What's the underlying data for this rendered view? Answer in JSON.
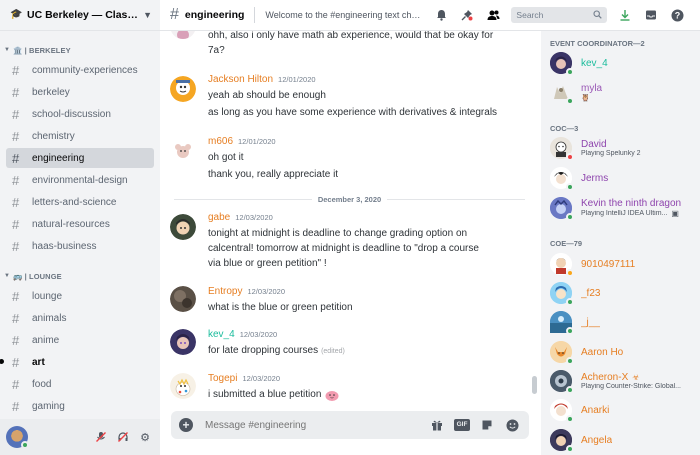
{
  "server": {
    "name": "UC Berkeley — Class o..."
  },
  "sidebar": {
    "categories": [
      {
        "label": "🏛️ | BERKELEY"
      },
      {
        "label": "🚌 | LOUNGE"
      }
    ],
    "channels": [
      {
        "label": "community-experiences"
      },
      {
        "label": "berkeley"
      },
      {
        "label": "school-discussion"
      },
      {
        "label": "chemistry"
      },
      {
        "label": "engineering"
      },
      {
        "label": "environmental-design"
      },
      {
        "label": "letters-and-science"
      },
      {
        "label": "natural-resources"
      },
      {
        "label": "haas-business"
      },
      {
        "label": "lounge"
      },
      {
        "label": "animals"
      },
      {
        "label": "anime"
      },
      {
        "label": "art"
      },
      {
        "label": "food"
      },
      {
        "label": "gaming"
      }
    ]
  },
  "topbar": {
    "channel": "engineering",
    "topic": "Welcome to the #engineering text cha...",
    "search_placeholder": "Search"
  },
  "messages": [
    {
      "lines": [
        "ohh, also i only have math ab experience, would that be okay for",
        "7a?"
      ]
    },
    {
      "author": "Jackson Hilton",
      "color": "#e67e22",
      "timestamp": "12/01/2020",
      "lines": [
        "yeah ab should be enough",
        "as long as you have some experience with derivatives & integrals"
      ]
    },
    {
      "author": "m606",
      "color": "#e67e22",
      "timestamp": "12/01/2020",
      "lines": [
        "oh got it",
        "thank you, really appreciate it"
      ]
    },
    {
      "author": "gabe",
      "color": "#e67e22",
      "timestamp": "12/03/2020",
      "lines": [
        "tonight at midnight is deadline to change grading option on",
        "calcentral! tomorrow at midnight is deadline to \"drop a course",
        "via blue or green petition\" !"
      ]
    },
    {
      "author": "Entropy",
      "color": "#e67e22",
      "timestamp": "12/03/2020",
      "lines": [
        "what is the blue or green petition"
      ]
    },
    {
      "author": "kev_4",
      "color": "#1abc9c",
      "timestamp": "12/03/2020",
      "lines": [
        "for late dropping courses"
      ],
      "edited": "(edited)"
    },
    {
      "author": "Togepi",
      "color": "#e67e22",
      "timestamp": "12/03/2020",
      "lines": [
        "i submitted a blue petition"
      ]
    }
  ],
  "date_divider": "December 3, 2020",
  "composer": {
    "placeholder": "Message #engineering"
  },
  "members": {
    "groups": [
      {
        "label": "EVENT COORDINATOR—2"
      },
      {
        "label": "COC—3"
      },
      {
        "label": "COE—79"
      }
    ],
    "list": [
      {
        "name": "kev_4",
        "color": "#1abc9c",
        "status": "#3ba55c"
      },
      {
        "name": "myla",
        "color": "#9b59b6",
        "status": "#3ba55c",
        "badge": "🦉"
      },
      {
        "name": "David",
        "color": "#8e44ad",
        "status": "#ed4245",
        "activity": "Playing Spelunky 2"
      },
      {
        "name": "Jerms",
        "color": "#8e44ad",
        "status": "#3ba55c"
      },
      {
        "name": "Kevin the ninth dragon",
        "color": "#8e44ad",
        "status": "#3ba55c",
        "activity": "Playing IntelliJ IDEA Ultim..."
      },
      {
        "name": "9010497111",
        "color": "#e67e22",
        "status": "#faa61a"
      },
      {
        "name": "_f23",
        "color": "#e67e22",
        "status": "#3ba55c"
      },
      {
        "name": "_j__",
        "color": "#e67e22",
        "status": "#3ba55c"
      },
      {
        "name": "Aaron Ho",
        "color": "#e67e22",
        "status": "#3ba55c"
      },
      {
        "name": "Acheron-X",
        "color": "#e67e22",
        "status": "#3ba55c",
        "badge": "☣",
        "activity": "Playing Counter-Strike: Global..."
      },
      {
        "name": "Anarki",
        "color": "#e67e22",
        "status": "#3ba55c"
      },
      {
        "name": "Angela",
        "color": "#e67e22",
        "status": "#3ba55c"
      }
    ]
  },
  "icons": [
    "server-icon",
    "chevron-down-icon",
    "hash-icon",
    "bell-icon",
    "pin-icon",
    "members-icon",
    "search-icon",
    "download-icon",
    "inbox-icon",
    "help-icon",
    "plus-icon",
    "gift-icon",
    "gif-icon",
    "sticker-icon",
    "emoji-icon",
    "mute-icon",
    "deafen-icon",
    "settings-icon"
  ]
}
